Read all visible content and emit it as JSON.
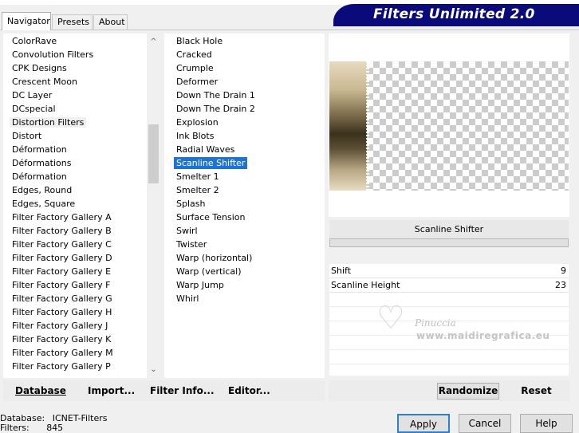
{
  "app": {
    "title": "Filters Unlimited 2.0"
  },
  "tabs": [
    {
      "label": "Navigator",
      "active": true
    },
    {
      "label": "Presets",
      "active": false
    },
    {
      "label": "About",
      "active": false
    }
  ],
  "categories": {
    "selected": "Distortion Filters",
    "items": [
      "ColorRave",
      "Convolution Filters",
      "CPK Designs",
      "Crescent Moon",
      "DC Layer",
      "DCspecial",
      "Distortion Filters",
      "Distort",
      "Déformation",
      "Déformations",
      "Déformation",
      "Edges, Round",
      "Edges, Square",
      "Filter Factory Gallery A",
      "Filter Factory Gallery B",
      "Filter Factory Gallery C",
      "Filter Factory Gallery D",
      "Filter Factory Gallery E",
      "Filter Factory Gallery F",
      "Filter Factory Gallery G",
      "Filter Factory Gallery H",
      "Filter Factory Gallery J",
      "Filter Factory Gallery K",
      "Filter Factory Gallery M",
      "Filter Factory Gallery P"
    ]
  },
  "filters": {
    "selected": "Scanline Shifter",
    "items": [
      "Black Hole",
      "Cracked",
      "Crumple",
      "Deformer",
      "Down The Drain 1",
      "Down The Drain 2",
      "Explosion",
      "Ink Blots",
      "Radial Waves",
      "Scanline Shifter",
      "Smelter 1",
      "Smelter 2",
      "Splash",
      "Surface Tension",
      "Swirl",
      "Twister",
      "Warp (horizontal)",
      "Warp (vertical)",
      "Warp Jump",
      "Whirl"
    ]
  },
  "filter_name": "Scanline Shifter",
  "params": [
    {
      "label": "Shift",
      "value": "9"
    },
    {
      "label": "Scanline Height",
      "value": "23"
    }
  ],
  "watermark": {
    "line1": "Pinuccia",
    "line2": "www.maidiregrafica.eu"
  },
  "left_buttons": {
    "database": "Database",
    "import": "Import...",
    "filter_info": "Filter Info...",
    "editor": "Editor..."
  },
  "right_buttons": {
    "randomize": "Randomize",
    "reset": "Reset"
  },
  "status": {
    "database_label": "Database:",
    "database_value": "ICNET-Filters",
    "filters_label": "Filters:",
    "filters_value": "845"
  },
  "dialog_buttons": {
    "apply": "Apply",
    "cancel": "Cancel",
    "help": "Help"
  },
  "colors": {
    "banner": "#0a0a7a",
    "selection": "#1e73d6"
  }
}
